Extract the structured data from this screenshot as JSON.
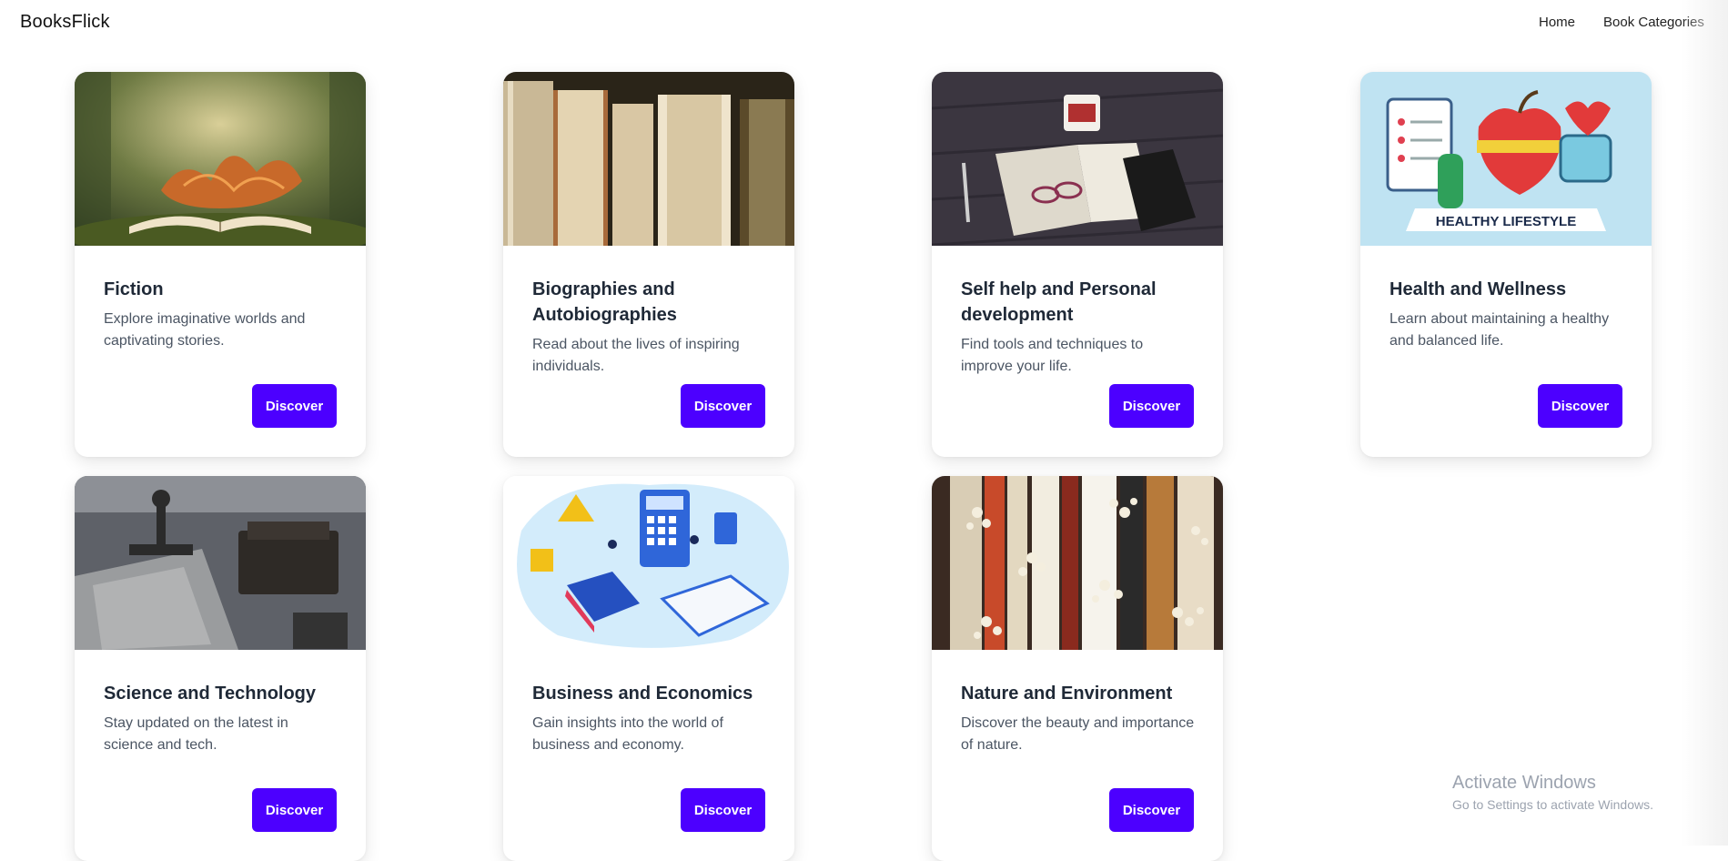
{
  "navbar": {
    "brand": "BooksFlick",
    "links": [
      "Home",
      "Book Categories"
    ]
  },
  "cards": [
    {
      "title": "Fiction",
      "description": "Explore imaginative worlds and captivating stories.",
      "button": "Discover",
      "image": "open-book-with-tree-image"
    },
    {
      "title": "Biographies and Autobiographies",
      "description": "Read about the lives of inspiring individuals.",
      "button": "Discover",
      "image": "old-book-spines-image"
    },
    {
      "title": "Self help and Personal development",
      "description": "Find tools and techniques to improve your life.",
      "button": "Discover",
      "image": "book-glasses-mug-image"
    },
    {
      "title": "Health and Wellness",
      "description": "Learn about maintaining a healthy and balanced life.",
      "button": "Discover",
      "image": "healthy-lifestyle-illustration",
      "image_banner": "HEALTHY LIFESTYLE"
    },
    {
      "title": "Science and Technology",
      "description": "Stay updated on the latest in science and tech.",
      "button": "Discover",
      "image": "microscope-desk-image"
    },
    {
      "title": "Business and Economics",
      "description": "Gain insights into the world of business and economy.",
      "button": "Discover",
      "image": "business-education-illustration"
    },
    {
      "title": "Nature and Environment",
      "description": "Discover the beauty and importance of nature.",
      "button": "Discover",
      "image": "books-with-flowers-image"
    }
  ],
  "watermark": {
    "line1": "Activate Windows",
    "line2": "Go to Settings to activate Windows."
  },
  "colors": {
    "accent": "#4c00ff",
    "title": "#1f2937",
    "text": "#4b5563"
  }
}
